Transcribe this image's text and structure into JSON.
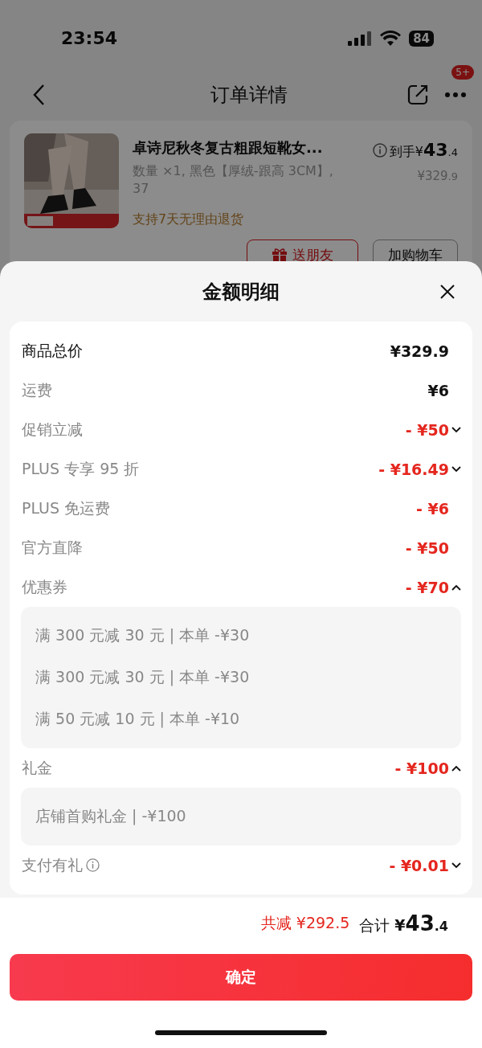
{
  "status_bar": {
    "time": "23:54",
    "battery": "84"
  },
  "header": {
    "title": "订单详情",
    "badge": "5+"
  },
  "product": {
    "title": "卓诗尼秋冬复古粗跟短靴女...",
    "spec": "数量 ×1, 黑色【厚绒-跟高 3CM】, 37",
    "price_label": "到手",
    "price_currency": "¥",
    "price_integer": "43",
    "price_decimal": ".4",
    "original_integer": "¥329",
    "original_decimal": ".9",
    "notice": "支持7天无理由退货",
    "actions": [
      {
        "label": "送朋友",
        "kind": "gift"
      },
      {
        "label": "加购物车",
        "kind": "plain"
      }
    ]
  },
  "sheet": {
    "title": "金额明细",
    "rows": [
      {
        "label": "商品总价",
        "amount": "¥329.9",
        "kind": "total"
      },
      {
        "label": "运费",
        "amount": "¥6",
        "kind": "charge"
      },
      {
        "label": "促销立减",
        "amount": "- ¥50",
        "kind": "discount",
        "expanded": false
      },
      {
        "label": "PLUS 专享 95 折",
        "amount": "- ¥16.49",
        "kind": "discount",
        "expanded": false
      },
      {
        "label": "PLUS 免运费",
        "amount": "- ¥6",
        "kind": "discount"
      },
      {
        "label": "官方直降",
        "amount": "- ¥50",
        "kind": "discount"
      },
      {
        "label": "优惠券",
        "amount": "- ¥70",
        "kind": "discount",
        "expanded": true,
        "details": [
          "满 300 元减 30 元 | 本单 -¥30",
          "满 300 元减 30 元 | 本单 -¥30",
          "满 50 元减 10 元 | 本单 -¥10"
        ]
      },
      {
        "label": "礼金",
        "amount": "- ¥100",
        "kind": "discount",
        "expanded": true,
        "details": [
          "店铺首购礼金 | -¥100"
        ]
      },
      {
        "label": "支付有礼",
        "amount": "- ¥0.01",
        "kind": "discount",
        "expanded": false,
        "info": true
      }
    ],
    "saved": "共减 ¥292.5",
    "total_label": "合计",
    "total_currency": "¥",
    "total_integer": "43",
    "total_decimal": ".4",
    "confirm": "确定"
  }
}
